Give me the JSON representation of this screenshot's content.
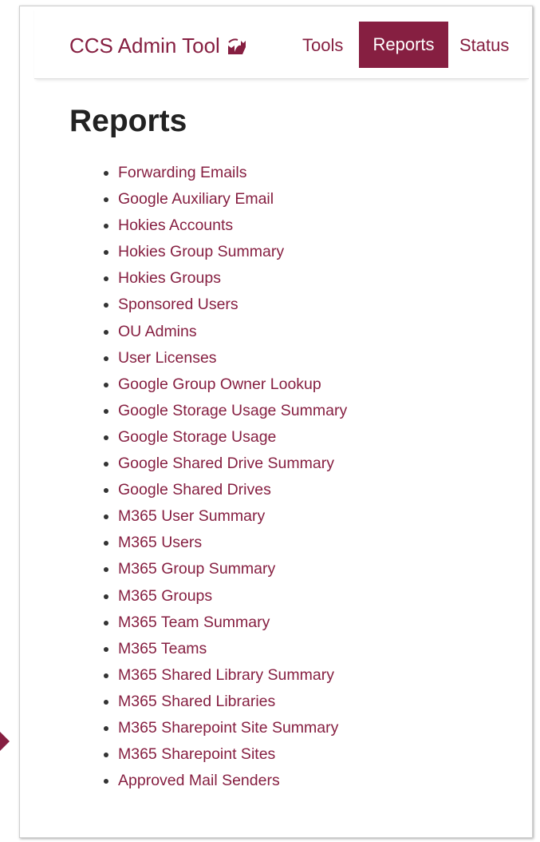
{
  "navbar": {
    "brand": "CCS Admin Tool",
    "brand_icon": "cat-icon",
    "tools": "Tools",
    "reports": "Reports",
    "status": "Status",
    "active_color": "#861f41"
  },
  "main": {
    "title": "Reports",
    "reports": [
      "Forwarding Emails",
      "Google Auxiliary Email",
      "Hokies Accounts",
      "Hokies Group Summary",
      "Hokies Groups",
      "Sponsored Users",
      "OU Admins",
      "User Licenses",
      "Google Group Owner Lookup",
      "Google Storage Usage Summary",
      "Google Storage Usage",
      "Google Shared Drive Summary",
      "Google Shared Drives",
      "M365 User Summary",
      "M365 Users",
      "M365 Group Summary",
      "M365 Groups",
      "M365 Team Summary",
      "M365 Teams",
      "M365 Shared Library Summary",
      "M365 Shared Libraries",
      "M365 Sharepoint Site Summary",
      "M365 Sharepoint Sites",
      "Approved Mail Senders"
    ]
  },
  "annotation": {
    "pointer_icon": "arrow-right-icon",
    "color": "#861f41"
  }
}
